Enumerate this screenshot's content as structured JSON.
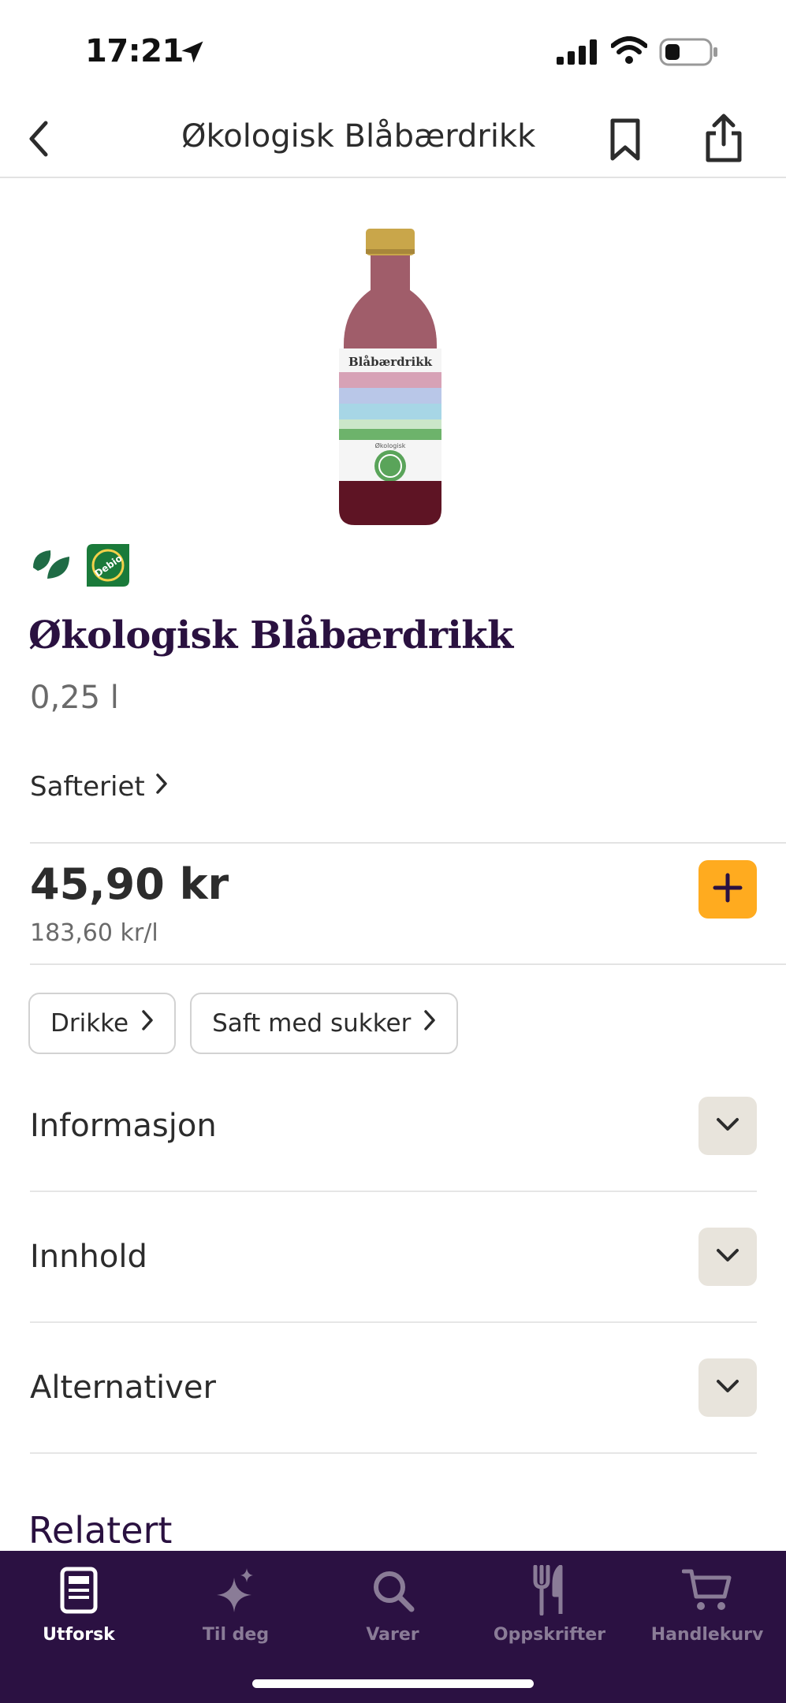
{
  "status_bar": {
    "time": "17:21"
  },
  "nav": {
    "title": "Økologisk Blåbærdrikk"
  },
  "product": {
    "label_brand_text": "Blåbærdrikk",
    "label_organic_text": "Økologisk",
    "name": "Økologisk Blåbærdrikk",
    "size": "0,25 l",
    "brand": "Safteriet",
    "price": "45,90 kr",
    "unit_price": "183,60 kr/l"
  },
  "badges": [
    {
      "icon": "leaf-icon",
      "color": "#1f6b45"
    },
    {
      "icon": "debio-organic-icon",
      "text": "Debio",
      "color": "#1a7a3a"
    }
  ],
  "categories": [
    {
      "label": "Drikke"
    },
    {
      "label": "Saft med sukker"
    }
  ],
  "sections": [
    {
      "label": "Informasjon"
    },
    {
      "label": "Innhold"
    },
    {
      "label": "Alternativer"
    }
  ],
  "related": {
    "title": "Relatert"
  },
  "tabs": [
    {
      "label": "Utforsk",
      "icon": "explore-icon",
      "active": true
    },
    {
      "label": "Til deg",
      "icon": "sparkle-icon",
      "active": false
    },
    {
      "label": "Varer",
      "icon": "search-icon",
      "active": false
    },
    {
      "label": "Oppskrifter",
      "icon": "fork-knife-icon",
      "active": false
    },
    {
      "label": "Handlekurv",
      "icon": "cart-icon",
      "active": false
    }
  ],
  "colors": {
    "accent": "#ffab1f",
    "brand_dark": "#2b1142",
    "heading": "#2a1140",
    "toggle_bg": "#e8e4dc"
  }
}
